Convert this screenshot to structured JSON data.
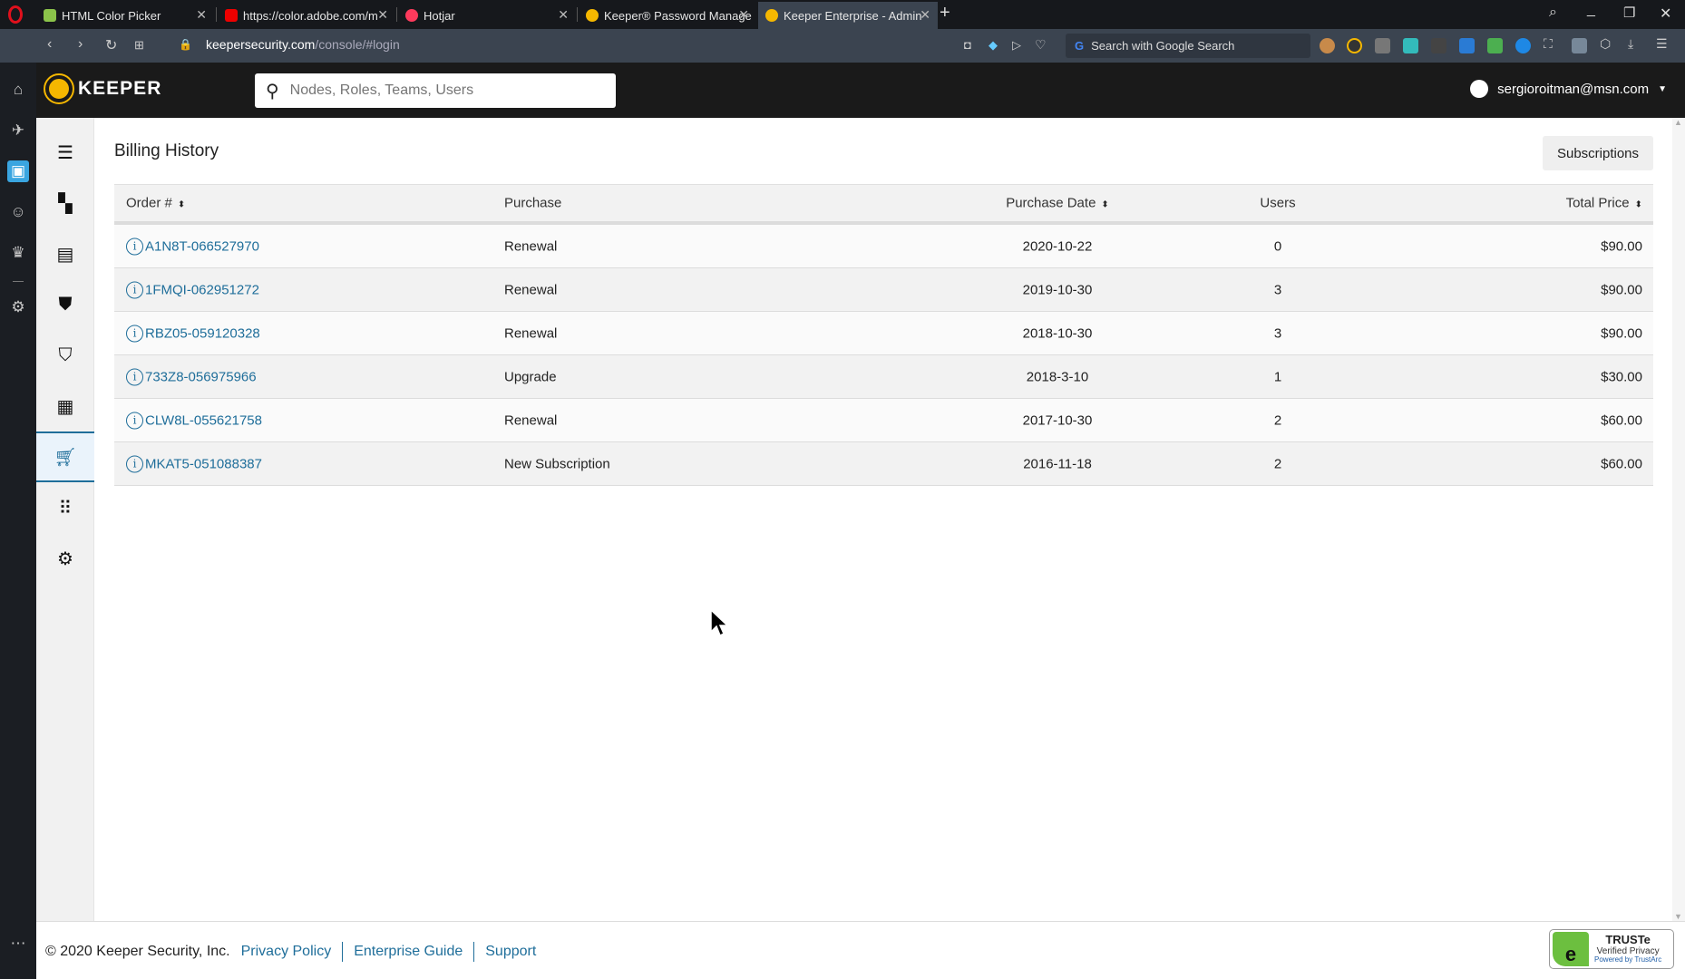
{
  "browser": {
    "tabs": [
      {
        "label": "HTML Color Picker",
        "favicon_color": "#8bc34a"
      },
      {
        "label": "https://color.adobe.com/m",
        "favicon_color": "#e00"
      },
      {
        "label": "Hotjar",
        "favicon_color": "#fd3a5c"
      },
      {
        "label": "Keeper® Password Manage",
        "favicon_color": "#f5b700"
      },
      {
        "label": "Keeper Enterprise - Admin",
        "favicon_color": "#f5b700",
        "active": true
      }
    ],
    "url_host": "keepersecurity.com",
    "url_path": "/console/#login",
    "search_placeholder": "Search with Google Search"
  },
  "header": {
    "logo": "KEEPER",
    "search_placeholder": "Nodes, Roles, Teams, Users",
    "user": "sergioroitman@msn.com"
  },
  "page": {
    "title": "Billing History",
    "subscriptions_button": "Subscriptions"
  },
  "table": {
    "columns": [
      "Order #",
      "Purchase",
      "Purchase Date",
      "Users",
      "Total Price"
    ],
    "rows": [
      {
        "order": "A1N8T-066527970",
        "purchase": "Renewal",
        "date": "2020-10-22",
        "users": "0",
        "price": "$90.00"
      },
      {
        "order": "1FMQI-062951272",
        "purchase": "Renewal",
        "date": "2019-10-30",
        "users": "3",
        "price": "$90.00"
      },
      {
        "order": "RBZ05-059120328",
        "purchase": "Renewal",
        "date": "2018-10-30",
        "users": "3",
        "price": "$90.00"
      },
      {
        "order": "733Z8-056975966",
        "purchase": "Upgrade",
        "date": "2018-3-10",
        "users": "1",
        "price": "$30.00"
      },
      {
        "order": "CLW8L-055621758",
        "purchase": "Renewal",
        "date": "2017-10-30",
        "users": "2",
        "price": "$60.00"
      },
      {
        "order": "MKAT5-051088387",
        "purchase": "New Subscription",
        "date": "2016-11-18",
        "users": "2",
        "price": "$60.00"
      }
    ]
  },
  "footer": {
    "copyright": "© 2020 Keeper Security, Inc.",
    "links": [
      "Privacy Policy",
      "Enterprise Guide",
      "Support"
    ],
    "badge": {
      "title": "TRUSTe",
      "subtitle": "Verified Privacy",
      "powered": "Powered by TrustArc"
    }
  },
  "colors": {
    "accent": "#1f6e9a",
    "brand": "#f5b700"
  }
}
